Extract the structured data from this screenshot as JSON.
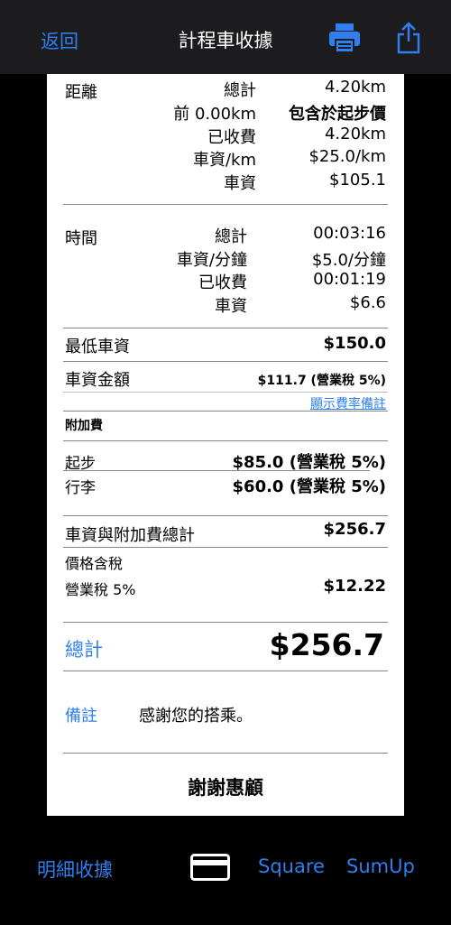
{
  "nav": {
    "back": "返回",
    "title": "計程車收據"
  },
  "distance": {
    "label": "距離",
    "total_label": "總計",
    "total_value": "4.20km",
    "prior": "前 0.00km",
    "prior_value": "包含於起步價",
    "charged_label": "已收費",
    "charged_value": "4.20km",
    "rate_label": "車資/km",
    "rate_value": "$25.0/km",
    "fare_label": "車資",
    "fare_value": "$105.1"
  },
  "time": {
    "label": "時間",
    "total_label": "總計",
    "total_value": "00:03:16",
    "rate_label": "車資/分鐘",
    "rate_value": "$5.0/分鐘",
    "charged_label": "已收費",
    "charged_value": "00:01:19",
    "fare_label": "車資",
    "fare_value": "$6.6"
  },
  "min_fare": {
    "label": "最低車資",
    "value": "$150.0"
  },
  "fare_amount": {
    "label": "車資金額",
    "value": "$111.7 (營業稅 5%)",
    "note_link": "顯示費率備註"
  },
  "surcharge": {
    "heading": "附加費",
    "items": [
      {
        "label": "起步",
        "value": "$85.0 (營業稅 5%)"
      },
      {
        "label": "行李",
        "value": "$60.0 (營業稅 5%)"
      }
    ]
  },
  "combined": {
    "label": "車資與附加費總計",
    "value": "$256.7"
  },
  "tax": {
    "included": "價格含稅",
    "label": "營業稅 5%",
    "value": "$12.22"
  },
  "total": {
    "label": "總計",
    "value": "$256.7"
  },
  "note": {
    "label": "備註",
    "text": "感謝您的搭乘。"
  },
  "thanks": "謝謝惠顧",
  "bottom": {
    "detail": "明細收據",
    "square": "Square",
    "sumup": "SumUp"
  },
  "icons": {
    "print": "print-icon",
    "share": "share-icon",
    "card": "card-icon"
  }
}
